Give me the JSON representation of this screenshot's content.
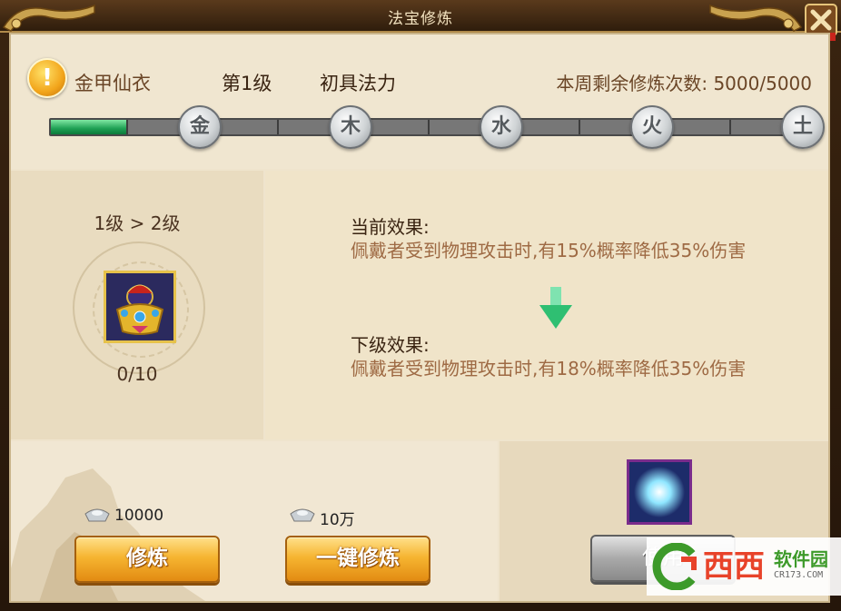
{
  "window": {
    "title": "法宝修炼"
  },
  "header": {
    "item_name": "金甲仙衣",
    "level": "第1级",
    "stage": "初具法力",
    "weekly_label": "本周剩余修炼次数:",
    "weekly_value": "5000/5000",
    "progress": 0.1
  },
  "elements": [
    "金",
    "木",
    "水",
    "火",
    "土"
  ],
  "upgrade": {
    "level_change": "1级 > 2级",
    "count": "0/10"
  },
  "effects": {
    "current_title": "当前效果:",
    "current_text": "佩戴者受到物理攻击时,有15%概率降低35%伤害",
    "next_title": "下级效果:",
    "next_text": "佩戴者受到物理攻击时,有18%概率降低35%伤害"
  },
  "actions": {
    "cost1": "10000",
    "train_label": "修炼",
    "cost2": "10万",
    "train_all_label": "一键修炼",
    "use_label": "使用"
  },
  "watermark": {
    "main": "西西",
    "sub": "软件园",
    "url": "CR173.COM"
  },
  "colors": {
    "progress": "#1ea054",
    "gold_button": "#f6b531",
    "use_button": "#a9a9a9"
  }
}
